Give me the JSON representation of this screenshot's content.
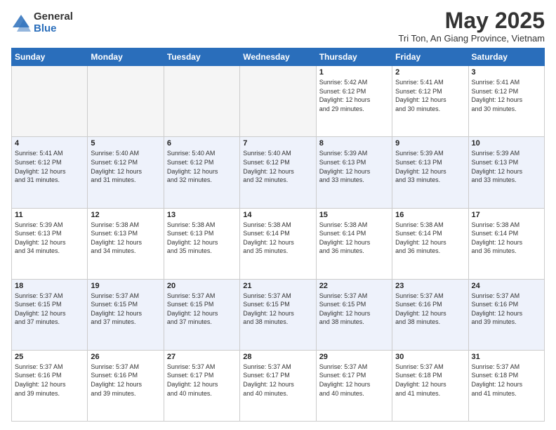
{
  "header": {
    "logo_general": "General",
    "logo_blue": "Blue",
    "month_title": "May 2025",
    "location": "Tri Ton, An Giang Province, Vietnam"
  },
  "days_of_week": [
    "Sunday",
    "Monday",
    "Tuesday",
    "Wednesday",
    "Thursday",
    "Friday",
    "Saturday"
  ],
  "weeks": [
    [
      {
        "day": "",
        "info": ""
      },
      {
        "day": "",
        "info": ""
      },
      {
        "day": "",
        "info": ""
      },
      {
        "day": "",
        "info": ""
      },
      {
        "day": "1",
        "info": "Sunrise: 5:42 AM\nSunset: 6:12 PM\nDaylight: 12 hours\nand 29 minutes."
      },
      {
        "day": "2",
        "info": "Sunrise: 5:41 AM\nSunset: 6:12 PM\nDaylight: 12 hours\nand 30 minutes."
      },
      {
        "day": "3",
        "info": "Sunrise: 5:41 AM\nSunset: 6:12 PM\nDaylight: 12 hours\nand 30 minutes."
      }
    ],
    [
      {
        "day": "4",
        "info": "Sunrise: 5:41 AM\nSunset: 6:12 PM\nDaylight: 12 hours\nand 31 minutes."
      },
      {
        "day": "5",
        "info": "Sunrise: 5:40 AM\nSunset: 6:12 PM\nDaylight: 12 hours\nand 31 minutes."
      },
      {
        "day": "6",
        "info": "Sunrise: 5:40 AM\nSunset: 6:12 PM\nDaylight: 12 hours\nand 32 minutes."
      },
      {
        "day": "7",
        "info": "Sunrise: 5:40 AM\nSunset: 6:12 PM\nDaylight: 12 hours\nand 32 minutes."
      },
      {
        "day": "8",
        "info": "Sunrise: 5:39 AM\nSunset: 6:13 PM\nDaylight: 12 hours\nand 33 minutes."
      },
      {
        "day": "9",
        "info": "Sunrise: 5:39 AM\nSunset: 6:13 PM\nDaylight: 12 hours\nand 33 minutes."
      },
      {
        "day": "10",
        "info": "Sunrise: 5:39 AM\nSunset: 6:13 PM\nDaylight: 12 hours\nand 33 minutes."
      }
    ],
    [
      {
        "day": "11",
        "info": "Sunrise: 5:39 AM\nSunset: 6:13 PM\nDaylight: 12 hours\nand 34 minutes."
      },
      {
        "day": "12",
        "info": "Sunrise: 5:38 AM\nSunset: 6:13 PM\nDaylight: 12 hours\nand 34 minutes."
      },
      {
        "day": "13",
        "info": "Sunrise: 5:38 AM\nSunset: 6:13 PM\nDaylight: 12 hours\nand 35 minutes."
      },
      {
        "day": "14",
        "info": "Sunrise: 5:38 AM\nSunset: 6:14 PM\nDaylight: 12 hours\nand 35 minutes."
      },
      {
        "day": "15",
        "info": "Sunrise: 5:38 AM\nSunset: 6:14 PM\nDaylight: 12 hours\nand 36 minutes."
      },
      {
        "day": "16",
        "info": "Sunrise: 5:38 AM\nSunset: 6:14 PM\nDaylight: 12 hours\nand 36 minutes."
      },
      {
        "day": "17",
        "info": "Sunrise: 5:38 AM\nSunset: 6:14 PM\nDaylight: 12 hours\nand 36 minutes."
      }
    ],
    [
      {
        "day": "18",
        "info": "Sunrise: 5:37 AM\nSunset: 6:15 PM\nDaylight: 12 hours\nand 37 minutes."
      },
      {
        "day": "19",
        "info": "Sunrise: 5:37 AM\nSunset: 6:15 PM\nDaylight: 12 hours\nand 37 minutes."
      },
      {
        "day": "20",
        "info": "Sunrise: 5:37 AM\nSunset: 6:15 PM\nDaylight: 12 hours\nand 37 minutes."
      },
      {
        "day": "21",
        "info": "Sunrise: 5:37 AM\nSunset: 6:15 PM\nDaylight: 12 hours\nand 38 minutes."
      },
      {
        "day": "22",
        "info": "Sunrise: 5:37 AM\nSunset: 6:15 PM\nDaylight: 12 hours\nand 38 minutes."
      },
      {
        "day": "23",
        "info": "Sunrise: 5:37 AM\nSunset: 6:16 PM\nDaylight: 12 hours\nand 38 minutes."
      },
      {
        "day": "24",
        "info": "Sunrise: 5:37 AM\nSunset: 6:16 PM\nDaylight: 12 hours\nand 39 minutes."
      }
    ],
    [
      {
        "day": "25",
        "info": "Sunrise: 5:37 AM\nSunset: 6:16 PM\nDaylight: 12 hours\nand 39 minutes."
      },
      {
        "day": "26",
        "info": "Sunrise: 5:37 AM\nSunset: 6:16 PM\nDaylight: 12 hours\nand 39 minutes."
      },
      {
        "day": "27",
        "info": "Sunrise: 5:37 AM\nSunset: 6:17 PM\nDaylight: 12 hours\nand 40 minutes."
      },
      {
        "day": "28",
        "info": "Sunrise: 5:37 AM\nSunset: 6:17 PM\nDaylight: 12 hours\nand 40 minutes."
      },
      {
        "day": "29",
        "info": "Sunrise: 5:37 AM\nSunset: 6:17 PM\nDaylight: 12 hours\nand 40 minutes."
      },
      {
        "day": "30",
        "info": "Sunrise: 5:37 AM\nSunset: 6:18 PM\nDaylight: 12 hours\nand 41 minutes."
      },
      {
        "day": "31",
        "info": "Sunrise: 5:37 AM\nSunset: 6:18 PM\nDaylight: 12 hours\nand 41 minutes."
      }
    ]
  ]
}
